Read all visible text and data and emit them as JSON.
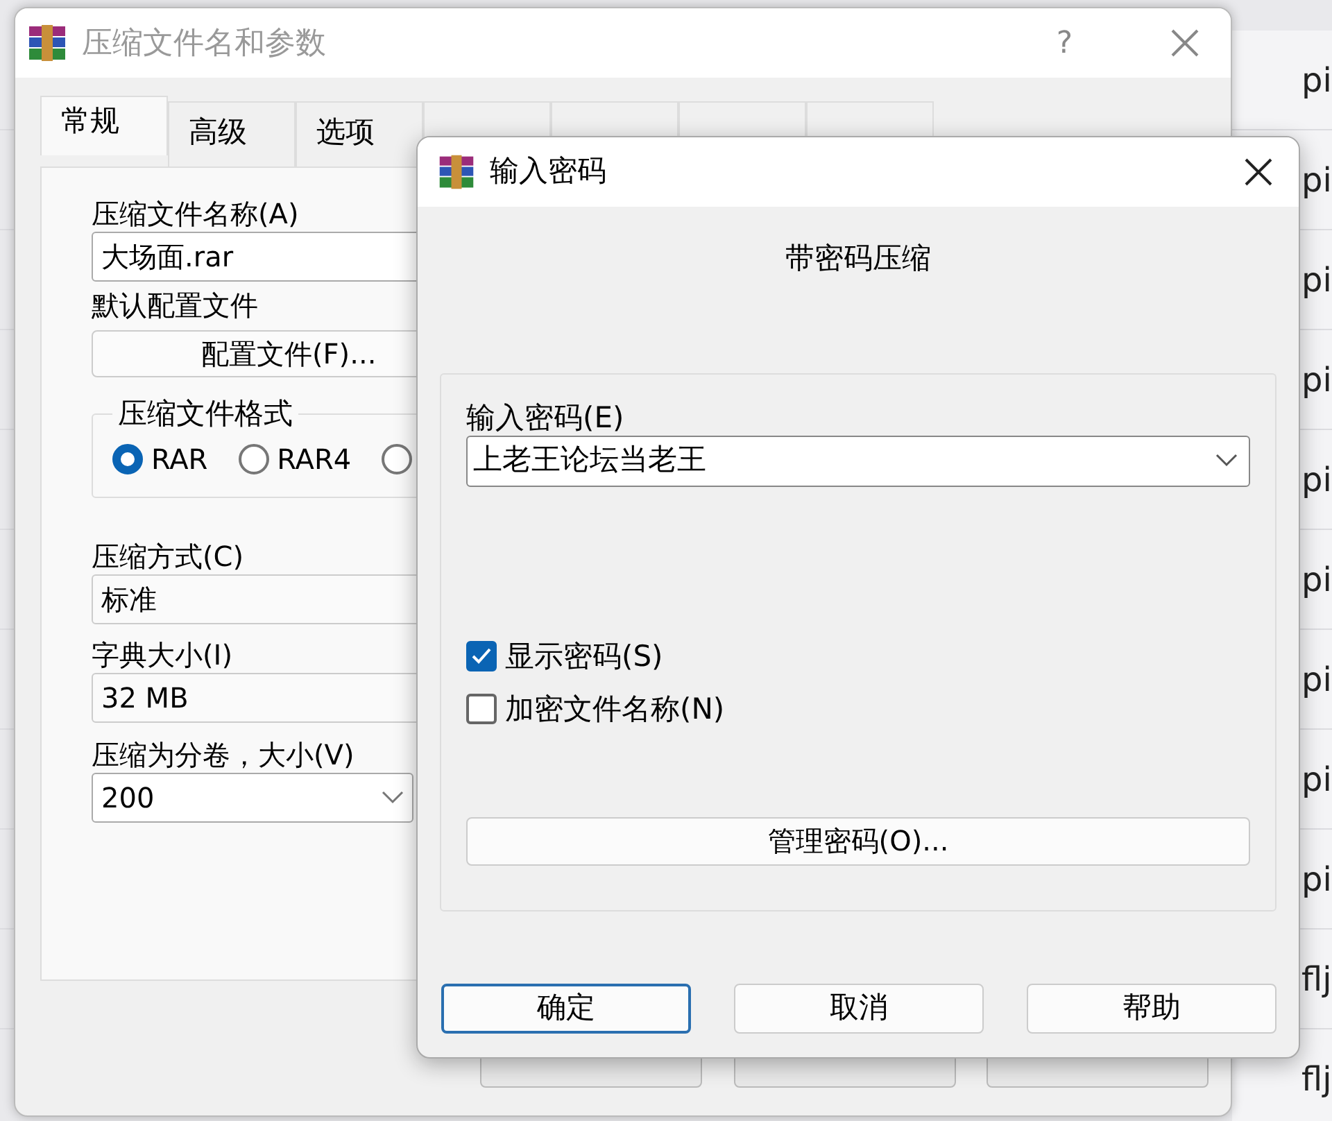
{
  "background_items": [
    "pi",
    "pi",
    "pi",
    "pi",
    "pi",
    "pi",
    "pi",
    "pi",
    "pi",
    "flj",
    "flj"
  ],
  "main_window": {
    "title": "压缩文件名和参数",
    "help_button": "?",
    "tabs": [
      {
        "label": "常规",
        "selected": true
      },
      {
        "label": "高级",
        "selected": false
      },
      {
        "label": "选项",
        "selected": false
      },
      {
        "selected": false
      },
      {
        "selected": false
      },
      {
        "selected": false
      },
      {
        "selected": false
      }
    ],
    "archive_name": {
      "label": "压缩文件名称(A)",
      "value": "大场面.rar"
    },
    "profile": {
      "label": "默认配置文件",
      "button": "配置文件(F)..."
    },
    "format": {
      "title": "压缩文件格式",
      "options": [
        {
          "label": "RAR",
          "selected": true
        },
        {
          "label": "RAR4",
          "selected": false
        },
        {
          "selected": false
        }
      ]
    },
    "method": {
      "label": "压缩方式(C)",
      "value": "标准"
    },
    "dictionary": {
      "label": "字典大小(I)",
      "value": "32 MB"
    },
    "split": {
      "label": "压缩为分卷，大小(V)",
      "value": "200"
    }
  },
  "password_dialog": {
    "title": "输入密码",
    "heading": "带密码压缩",
    "password": {
      "label": "输入密码(E)",
      "value": "上老王论坛当老王"
    },
    "options": [
      {
        "label": "显示密码(S)",
        "checked": true
      },
      {
        "label": "加密文件名称(N)",
        "checked": false
      }
    ],
    "manage_button": "管理密码(O)...",
    "buttons": [
      {
        "label": "确定",
        "default": true
      },
      {
        "label": "取消",
        "default": false
      },
      {
        "label": "帮助",
        "default": false
      }
    ]
  }
}
